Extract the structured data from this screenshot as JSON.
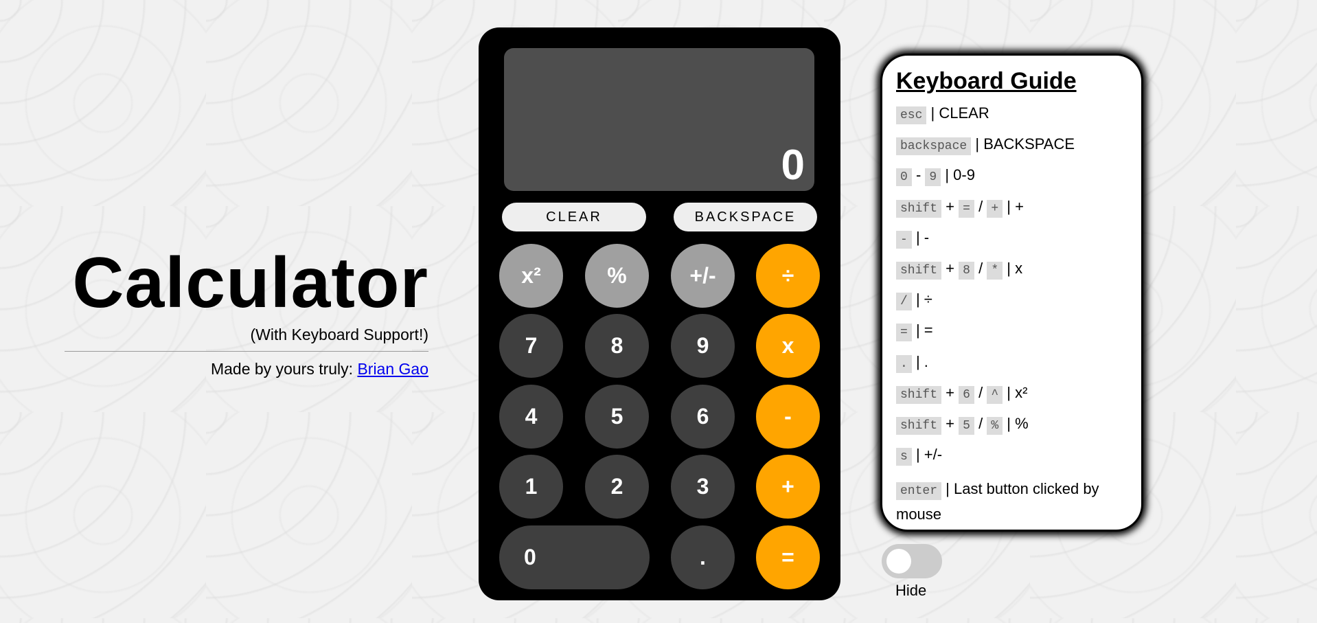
{
  "title": "Calculator",
  "subtitle": "(With Keyboard Support!)",
  "credit": {
    "prefix": "Made by yours truly: ",
    "link_text": "Brian Gao"
  },
  "display": {
    "value": "0"
  },
  "controls": {
    "clear": "CLEAR",
    "backspace": "BACKSPACE"
  },
  "keys": {
    "square": "x²",
    "percent": "%",
    "negate": "+/-",
    "divide": "÷",
    "seven": "7",
    "eight": "8",
    "nine": "9",
    "multiply": "x",
    "four": "4",
    "five": "5",
    "six": "6",
    "subtract": "-",
    "one": "1",
    "two": "2",
    "three": "3",
    "add": "+",
    "zero": "0",
    "decimal": ".",
    "equals": "="
  },
  "guide": {
    "title": "Keyboard Guide",
    "rows": [
      {
        "keys": [
          "esc"
        ],
        "joiners": [],
        "action": "CLEAR"
      },
      {
        "keys": [
          "backspace"
        ],
        "joiners": [],
        "action": "BACKSPACE"
      },
      {
        "keys": [
          "0",
          "9"
        ],
        "joiners": [
          "-"
        ],
        "action": "0-9"
      },
      {
        "keys": [
          "shift",
          "=",
          "+"
        ],
        "joiners": [
          "+",
          "/"
        ],
        "action": "+"
      },
      {
        "keys": [
          "-"
        ],
        "joiners": [],
        "action": "-"
      },
      {
        "keys": [
          "shift",
          "8",
          "*"
        ],
        "joiners": [
          "+",
          "/"
        ],
        "action": "x"
      },
      {
        "keys": [
          "/"
        ],
        "joiners": [],
        "action": "÷"
      },
      {
        "keys": [
          "="
        ],
        "joiners": [],
        "action": "="
      },
      {
        "keys": [
          "."
        ],
        "joiners": [],
        "action": "."
      },
      {
        "keys": [
          "shift",
          "6",
          "^"
        ],
        "joiners": [
          "+",
          "/"
        ],
        "action": "x²"
      },
      {
        "keys": [
          "shift",
          "5",
          "%"
        ],
        "joiners": [
          "+",
          "/"
        ],
        "action": "%"
      },
      {
        "keys": [
          "s"
        ],
        "joiners": [],
        "action": "+/-"
      },
      {
        "keys": [
          "enter"
        ],
        "joiners": [],
        "action": "Last button clicked by mouse"
      }
    ],
    "separator": "|"
  },
  "toggle": {
    "label": "Hide",
    "on": false
  },
  "colors": {
    "operator": "#ffa500",
    "function": "#a0a0a0",
    "digit": "#3f3f3f",
    "display": "#4e4e4e"
  }
}
